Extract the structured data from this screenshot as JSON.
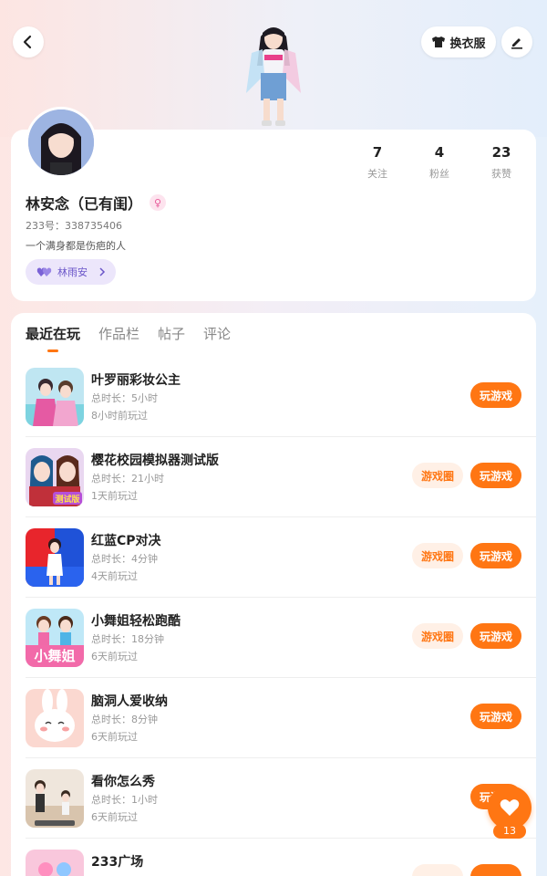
{
  "header": {
    "outfit_label": "换衣服"
  },
  "profile": {
    "name": "林安念（已有闺）",
    "gender_symbol": "♀",
    "uid": "233号：338735406",
    "bio": "一个满身都是伤疤的人",
    "cp_name": "林雨安",
    "stats": [
      {
        "value": "7",
        "label": "关注"
      },
      {
        "value": "4",
        "label": "粉丝"
      },
      {
        "value": "23",
        "label": "获赞"
      }
    ]
  },
  "tabs": [
    "最近在玩",
    "作品栏",
    "帖子",
    "评论"
  ],
  "games": [
    {
      "title": "叶罗丽彩妆公主",
      "duration": "总时长：5小时",
      "last_played": "8小时前玩过",
      "play_label": "玩游戏",
      "circle_label": ""
    },
    {
      "title": "樱花校园模拟器测试版",
      "duration": "总时长：21小时",
      "last_played": "1天前玩过",
      "play_label": "玩游戏",
      "circle_label": "游戏圈"
    },
    {
      "title": "红蓝CP对决",
      "duration": "总时长：4分钟",
      "last_played": "4天前玩过",
      "play_label": "玩游戏",
      "circle_label": "游戏圈"
    },
    {
      "title": "小舞姐轻松跑酷",
      "duration": "总时长：18分钟",
      "last_played": "6天前玩过",
      "play_label": "玩游戏",
      "circle_label": "游戏圈"
    },
    {
      "title": "脑洞人爱收纳",
      "duration": "总时长：8分钟",
      "last_played": "6天前玩过",
      "play_label": "玩游戏",
      "circle_label": ""
    },
    {
      "title": "看你怎么秀",
      "duration": "总时长：1小时",
      "last_played": "6天前玩过",
      "play_label": "玩游戏",
      "circle_label": ""
    },
    {
      "title": "233广场",
      "duration": "",
      "last_played": "",
      "play_label": "",
      "circle_label": ""
    }
  ],
  "icon_text": {
    "xiaowujie": "小舞姐",
    "test_badge": "测试版"
  },
  "like": {
    "count": "13"
  },
  "colors": {
    "accent": "#ff7613",
    "cp_tag_bg": "#ece6fb",
    "cp_tag_text": "#6b56c9"
  }
}
